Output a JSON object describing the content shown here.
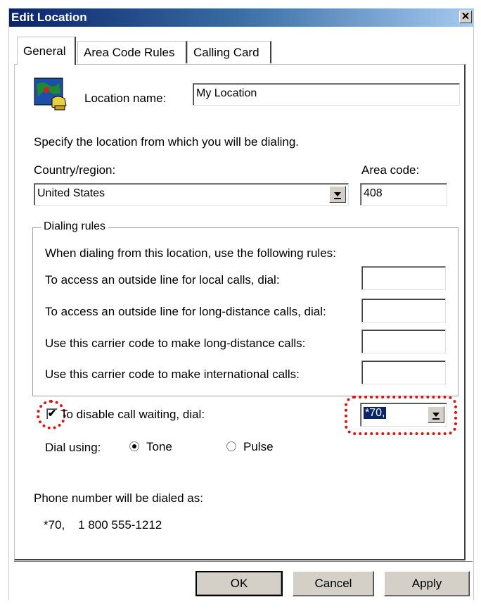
{
  "window": {
    "title": "Edit Location",
    "close_glyph": "✕"
  },
  "tabs": [
    {
      "label": "General"
    },
    {
      "label": "Area Code Rules"
    },
    {
      "label": "Calling Card"
    }
  ],
  "location": {
    "label": "Location name:",
    "value": "My Location"
  },
  "specify_text": "Specify the location from which you will be dialing.",
  "country": {
    "label": "Country/region:",
    "value": "United States"
  },
  "area_code": {
    "label": "Area code:",
    "value": "408"
  },
  "dialing_rules": {
    "title": "Dialing rules",
    "intro": "When dialing from this location, use the following rules:",
    "rows": [
      {
        "label": "To access an outside line for local calls, dial:",
        "value": ""
      },
      {
        "label": "To access an outside line for long-distance calls, dial:",
        "value": ""
      },
      {
        "label": "Use this carrier code to make long-distance calls:",
        "value": ""
      },
      {
        "label": "Use this carrier code to make international calls:",
        "value": ""
      }
    ]
  },
  "call_waiting": {
    "label": "To disable call waiting, dial:",
    "checked": true,
    "check_glyph": "✔",
    "value": "*70,"
  },
  "dial_using": {
    "label": "Dial using:",
    "tone": "Tone",
    "pulse": "Pulse",
    "selected": "Tone"
  },
  "phone_number": {
    "label": "Phone number will be dialed as:",
    "value": "*70,    1 800 555-1212"
  },
  "buttons": {
    "ok": "OK",
    "cancel": "Cancel",
    "apply": "Apply"
  },
  "colors": {
    "highlight": "#0a246a",
    "annotation": "#e01010"
  }
}
